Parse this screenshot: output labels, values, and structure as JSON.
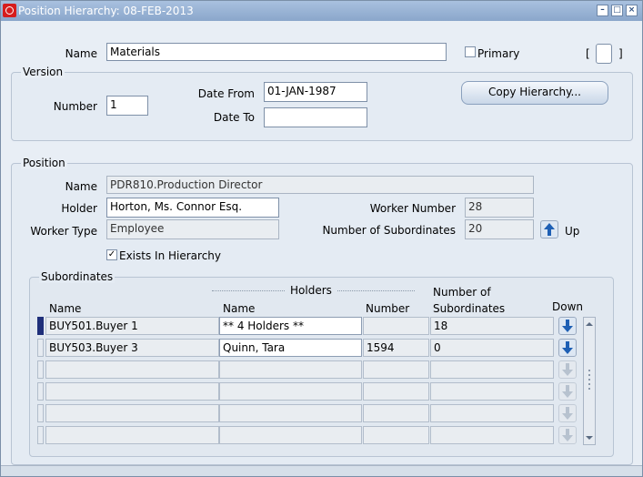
{
  "window": {
    "title": "Position Hierarchy: 08-FEB-2013",
    "controls": [
      "minimize-icon",
      "maximize-icon",
      "close-icon"
    ]
  },
  "header": {
    "name_label": "Name",
    "name_value": "Materials",
    "primary_label": "Primary",
    "primary_checked": false,
    "bracket_open": "[",
    "bracket_close": "]"
  },
  "version": {
    "group_title": "Version",
    "number_label": "Number",
    "number_value": "1",
    "date_from_label": "Date From",
    "date_from_value": "01-JAN-1987",
    "date_to_label": "Date To",
    "date_to_value": "",
    "copy_button": "Copy Hierarchy..."
  },
  "position": {
    "group_title": "Position",
    "name_label": "Name",
    "name_value": "PDR810.Production Director",
    "holder_label": "Holder",
    "holder_value": "Horton, Ms. Connor Esq.",
    "worker_number_label": "Worker Number",
    "worker_number_value": "28",
    "worker_type_label": "Worker Type",
    "worker_type_value": "Employee",
    "subordinates_label": "Number of Subordinates",
    "subordinates_value": "20",
    "up_label": "Up",
    "exists_label": "Exists In Hierarchy",
    "exists_checked": true
  },
  "subordinates": {
    "group_title": "Subordinates",
    "holders_header": "Holders",
    "col_name": "Name",
    "col_holder_name": "Name",
    "col_number": "Number",
    "col_subordinates_line1": "Number of",
    "col_subordinates_line2": "Subordinates",
    "col_down": "Down",
    "rows": [
      {
        "name": "BUY501.Buyer 1",
        "holder": "** 4 Holders **",
        "number": "",
        "subordinates": "18"
      },
      {
        "name": "BUY503.Buyer 3",
        "holder": "Quinn, Tara",
        "number": "1594",
        "subordinates": "0"
      },
      {
        "name": "",
        "holder": "",
        "number": "",
        "subordinates": ""
      },
      {
        "name": "",
        "holder": "",
        "number": "",
        "subordinates": ""
      },
      {
        "name": "",
        "holder": "",
        "number": "",
        "subordinates": ""
      },
      {
        "name": "",
        "holder": "",
        "number": "",
        "subordinates": ""
      }
    ]
  },
  "colors": {
    "titlebar": "#8aa6cb",
    "current_row": "#1f2f7a",
    "arrow_active": "#1e5fb4"
  }
}
